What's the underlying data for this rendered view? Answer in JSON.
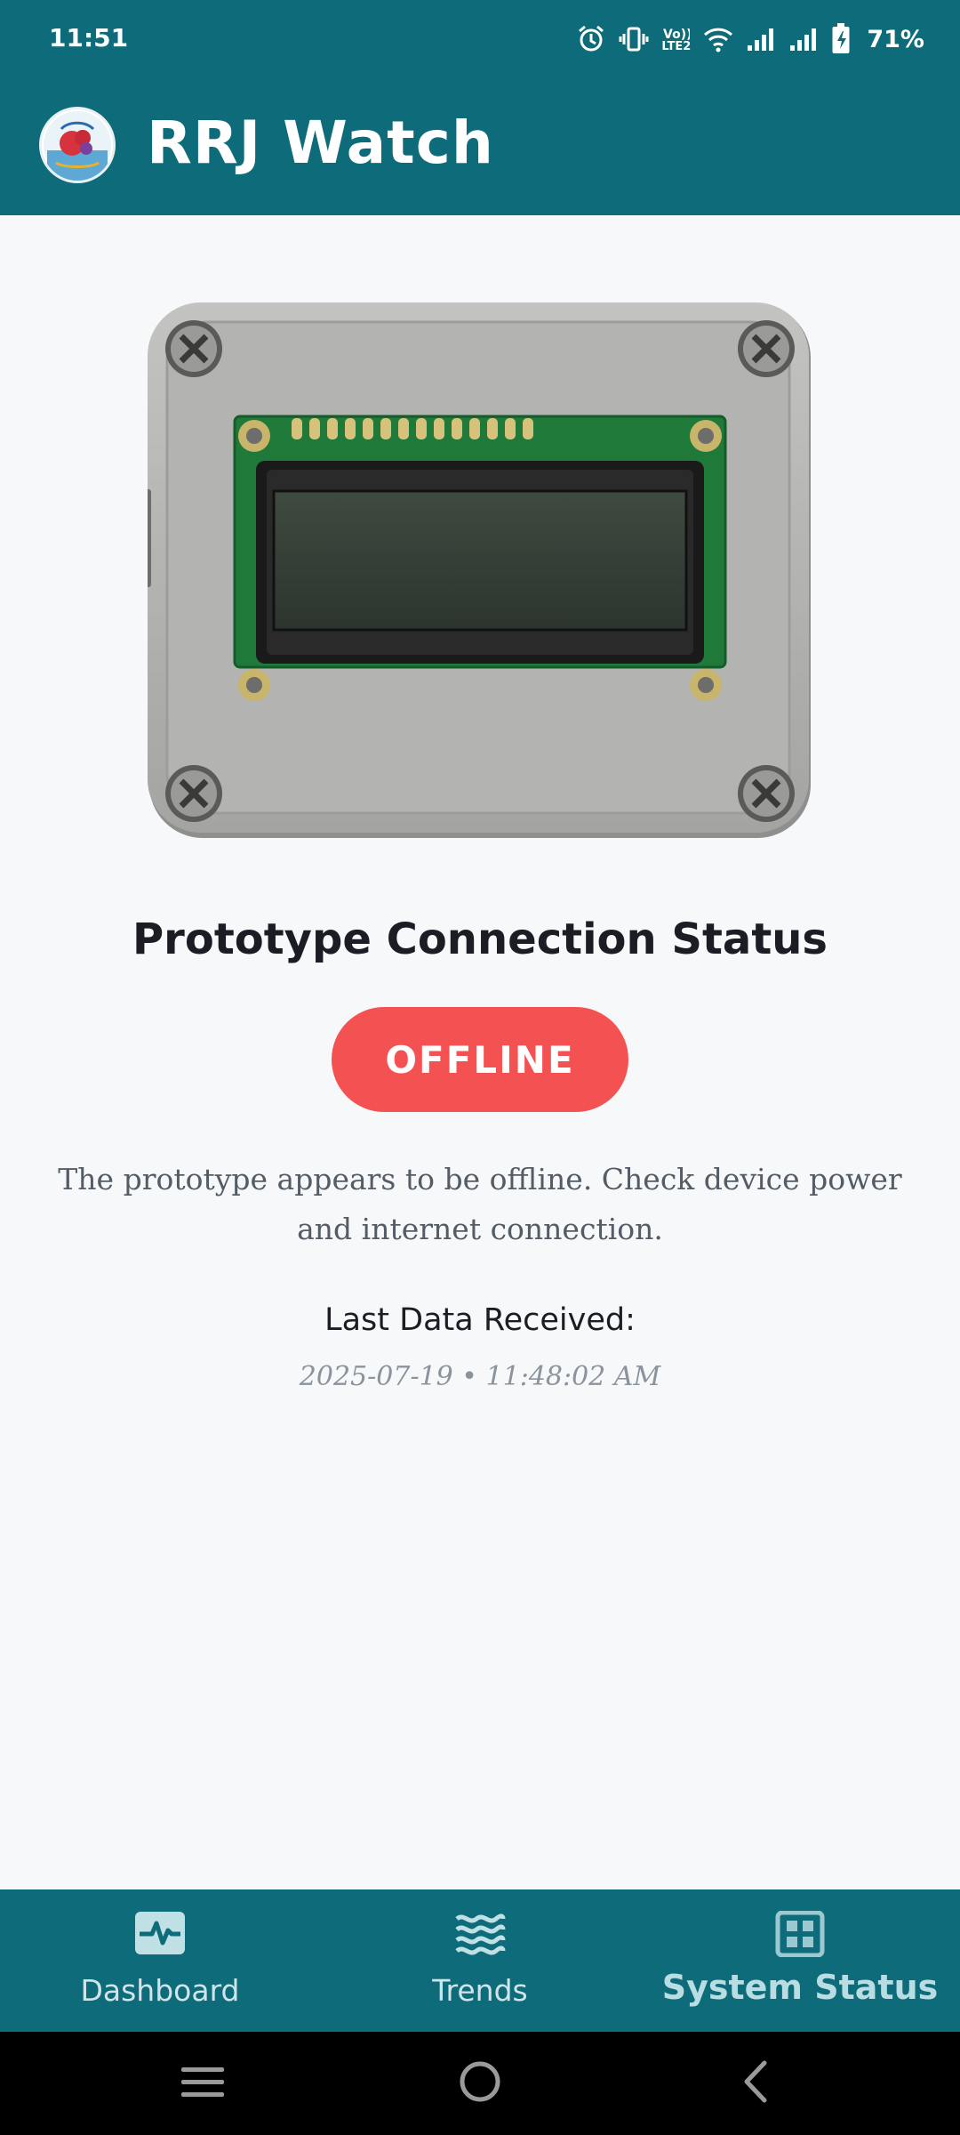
{
  "status_bar": {
    "time": "11:51",
    "battery_pct": "71%",
    "network_label": "LTE2",
    "icons": [
      "alarm-icon",
      "vibrate-icon",
      "volte-icon",
      "wifi-icon",
      "signal-icon",
      "signal-icon",
      "battery-charging-icon"
    ]
  },
  "app": {
    "title": "RRJ Watch",
    "logo_icon": "app-logo-icon"
  },
  "device": {
    "image_icon": "lcd-device-image"
  },
  "status": {
    "section_title": "Prototype Connection Status",
    "badge": "OFFLINE",
    "badge_color": "#f45252",
    "description": "The prototype appears to be offline. Check device power and internet connection.",
    "last_label": "Last Data Received:",
    "last_value": "2025-07-19 • 11:48:02 AM"
  },
  "nav": {
    "items": [
      {
        "label": "Dashboard",
        "icon": "pulse-icon",
        "active": false
      },
      {
        "label": "Trends",
        "icon": "waves-icon",
        "active": false
      },
      {
        "label": "System Status",
        "icon": "chip-icon",
        "active": true
      }
    ]
  },
  "system_nav": {
    "icons": [
      "recents-icon",
      "home-icon",
      "back-icon"
    ]
  },
  "colors": {
    "primary": "#0e6b7a",
    "background": "#f7f8fa",
    "offline": "#f45252"
  }
}
